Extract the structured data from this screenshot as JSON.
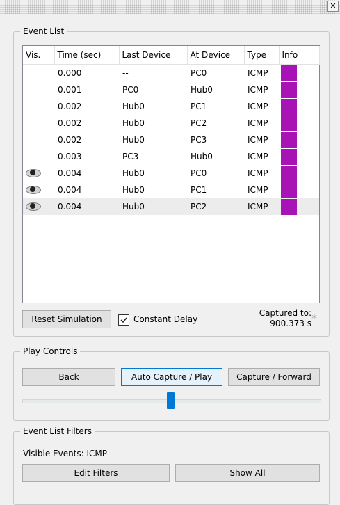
{
  "window": {
    "close_glyph": "✕"
  },
  "event_list": {
    "legend": "Event List",
    "columns": [
      "Vis.",
      "Time (sec)",
      "Last Device",
      "At Device",
      "Type",
      "Info"
    ],
    "rows": [
      {
        "time": "0.000",
        "last": "--",
        "at": "PC0",
        "type": "ICMP"
      },
      {
        "time": "0.001",
        "last": "PC0",
        "at": "Hub0",
        "type": "ICMP"
      },
      {
        "time": "0.002",
        "last": "Hub0",
        "at": "PC1",
        "type": "ICMP"
      },
      {
        "time": "0.002",
        "last": "Hub0",
        "at": "PC2",
        "type": "ICMP"
      },
      {
        "time": "0.002",
        "last": "Hub0",
        "at": "PC3",
        "type": "ICMP"
      },
      {
        "time": "0.003",
        "last": "PC3",
        "at": "Hub0",
        "type": "ICMP"
      },
      {
        "time": "0.004",
        "last": "Hub0",
        "at": "PC0",
        "type": "ICMP"
      },
      {
        "time": "0.004",
        "last": "Hub0",
        "at": "PC1",
        "type": "ICMP"
      },
      {
        "time": "0.004",
        "last": "Hub0",
        "at": "PC2",
        "type": "ICMP"
      }
    ],
    "info_color": "#a813b5",
    "reset_label": "Reset Simulation",
    "constant_delay_label": "Constant Delay",
    "captured_label": "Captured to:",
    "captured_value": "900.373 s",
    "asterisk": "*"
  },
  "play_controls": {
    "legend": "Play Controls",
    "back_label": "Back",
    "auto_label": "Auto Capture / Play",
    "forward_label": "Capture / Forward"
  },
  "filters": {
    "legend": "Event List Filters",
    "visible_events_label": "Visible Events:",
    "visible_events_value": "ICMP",
    "edit_label": "Edit Filters",
    "show_all_label": "Show All"
  }
}
